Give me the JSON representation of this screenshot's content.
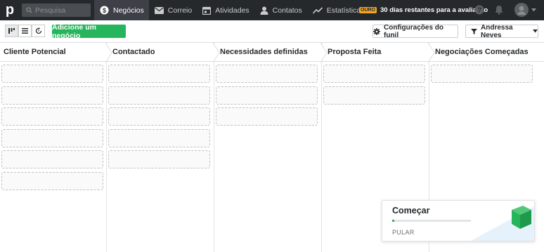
{
  "nav": {
    "logo": "p",
    "search_placeholder": "Pesquisa",
    "items": [
      {
        "label": "Negócios",
        "icon": "dollar-icon",
        "active": true
      },
      {
        "label": "Correio",
        "icon": "mail-icon",
        "active": false
      },
      {
        "label": "Atividades",
        "icon": "calendar-icon",
        "active": false
      },
      {
        "label": "Contatos",
        "icon": "person-icon",
        "active": false
      },
      {
        "label": "Estatísticas",
        "icon": "chart-line-icon",
        "active": false
      }
    ],
    "trial_badge": "OURO",
    "trial_text": "30 dias restantes para a avaliação",
    "icons": [
      "help-icon",
      "bell-icon",
      "avatar-icon"
    ]
  },
  "toolbar": {
    "view_buttons": [
      "pipeline-view-icon",
      "list-view-icon",
      "forecast-view-icon"
    ],
    "add_deal_label": "Adicione um negócio",
    "pipeline_settings_label": "Configurações do funil",
    "user_filter_label": "Andressa Neves"
  },
  "stages": [
    {
      "name": "Cliente Potencial",
      "cards": 6
    },
    {
      "name": "Contactado",
      "cards": 5
    },
    {
      "name": "Necessidades definidas",
      "cards": 3
    },
    {
      "name": "Proposta Feita",
      "cards": 2
    },
    {
      "name": "Negociações Começadas",
      "cards": 1
    }
  ],
  "onboarding": {
    "title": "Começar",
    "skip_label": "PULAR",
    "progress": 0.03
  },
  "colors": {
    "topbar": "#26292c",
    "accent_green": "#26b55c",
    "badge": "#f5a623"
  }
}
